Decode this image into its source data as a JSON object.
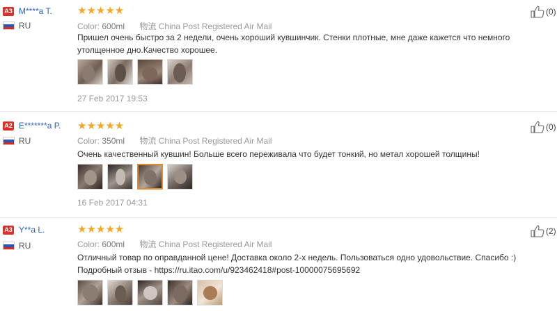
{
  "reviews": [
    {
      "badge": "A3",
      "user": "M****a T.",
      "country": "RU",
      "stars": "★★★★★",
      "color_label": "Color:",
      "color_value": "600ml",
      "shipping": "物流 China Post Registered Air Mail",
      "text": "Пришел очень быстро за 2 недели, очень хороший кувшинчик. Стенки плотные, мне даже кажется что немного утолщенное дно.Качество хорошее.",
      "date": "27 Feb 2017 19:53",
      "likes": "(0)",
      "photos": 4
    },
    {
      "badge": "A2",
      "user": "E*******a P.",
      "country": "RU",
      "stars": "★★★★★",
      "color_label": "Color:",
      "color_value": "350ml",
      "shipping": "物流 China Post Registered Air Mail",
      "text": "Очень качественный кувшин! Больше всего переживала что будет тонкий, но метал хорошей толщины!",
      "date": "16 Feb 2017 04:31",
      "likes": "(0)",
      "photos": 4
    },
    {
      "badge": "A3",
      "user": "Y**a L.",
      "country": "RU",
      "stars": "★★★★★",
      "color_label": "Color:",
      "color_value": "600ml",
      "shipping": "物流 China Post Registered Air Mail",
      "text": "Отличный товар по оправданной цене! Доставка около 2-х недель. Пользоваться одно удовольствие. Спасибо :) Подробный отзыв - https://ru.itao.com/u/923462418#post-10000075695692",
      "date": "",
      "likes": "(2)",
      "photos": 5
    }
  ],
  "colors": {
    "accent_star": "#f5a623",
    "username": "#2e63b8",
    "badge": "#d9302a"
  }
}
